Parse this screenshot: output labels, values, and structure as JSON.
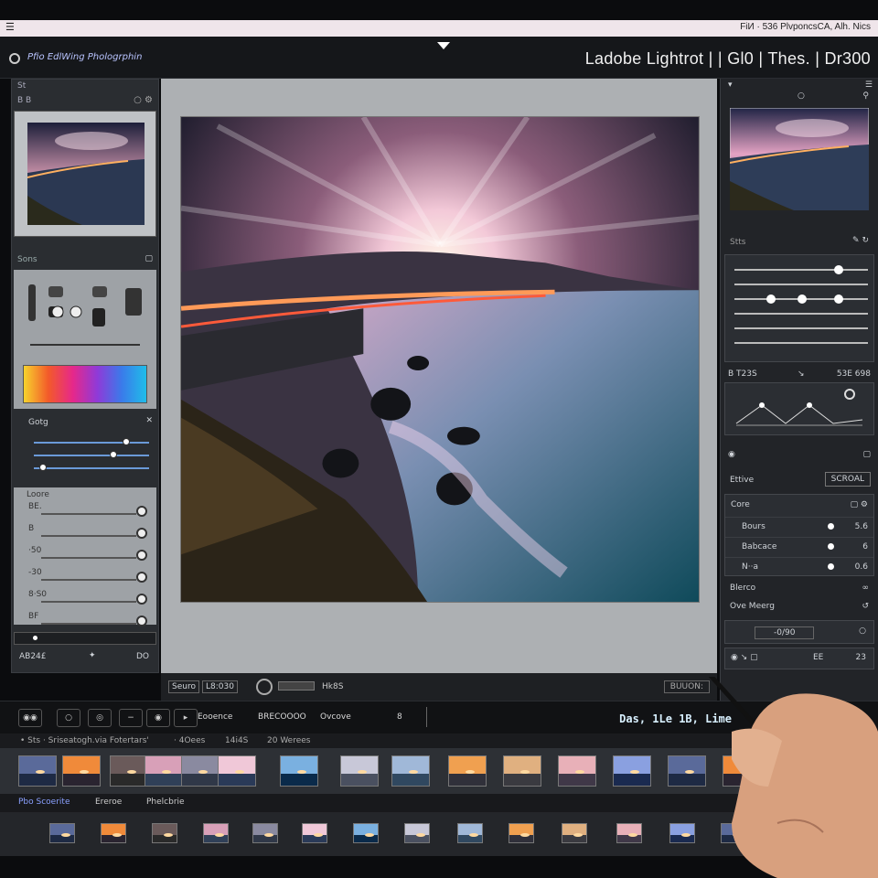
{
  "system_bar": {
    "right_text": "FiИ · 536 PlvponcsСA, Alh. Nics",
    "left_icon": "menu-icon"
  },
  "app": {
    "name": "Pfio EdlWing Phologrphin",
    "title": "Ladobe Lightrot | | Gl0 | Thes. | Dr300"
  },
  "left_panel": {
    "nav_label": "St",
    "nav_sub": "B B",
    "section_tone": "Sons",
    "section_color": "Gotg",
    "sliders": [
      {
        "label": "×",
        "value": 0.82
      },
      {
        "label": "×",
        "value": 0.7
      },
      {
        "label": "·",
        "value": 0.05
      }
    ],
    "adjust_header": "Loore",
    "adjust_rows": [
      {
        "label": "BE."
      },
      {
        "label": "B"
      },
      {
        "label": "·50"
      },
      {
        "label": "-30"
      },
      {
        "label": "8·S0"
      },
      {
        "label": "BF"
      }
    ],
    "bottom_label": "AB24£",
    "bottom_value": "DO"
  },
  "center_bar": {
    "button_left": "Seuro",
    "button_mid": "L8:030",
    "label": "Hk8S",
    "button_right": "BUUON:"
  },
  "right_panel": {
    "sect_stats": "Stts",
    "hist_left": "B T23S",
    "hist_right": "53E 698",
    "effective": "Ettive",
    "effective_btn": "SCROAL",
    "core": "Core",
    "rows": [
      {
        "label": "Bours",
        "value": "5.6"
      },
      {
        "label": "Babcace",
        "value": "6"
      },
      {
        "label": "N··a",
        "value": "0.6"
      }
    ],
    "sect_blend": "Blerco",
    "sect_overmerg": "Ove Meerg",
    "field_value": "-0/90",
    "ee_label": "EE",
    "tail_value": "23"
  },
  "toolbar": {
    "tabs": [
      "Eooence",
      "BRECOOOO",
      "Ovcove"
    ],
    "counter": "8",
    "date": "Das,  1Le 1B, Lime"
  },
  "filmstrip": {
    "header": [
      "• Sts  · Sriseatogh.via Fotertars'",
      "· 4Oees",
      "14i4S",
      "20 Werees"
    ],
    "second_header": [
      "Pbo Scoerite",
      "Ereroe",
      "Phelcbrie"
    ]
  },
  "colors": {
    "accent": "#6a9ad8",
    "panel": "#2a2d31",
    "canvas": "#adb0b3"
  }
}
